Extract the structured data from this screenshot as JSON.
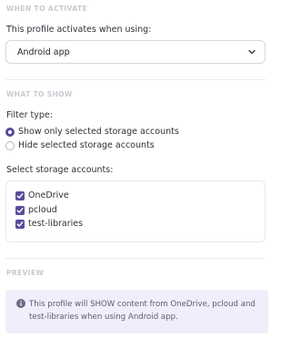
{
  "activate": {
    "section_title": "WHEN TO ACTIVATE",
    "prompt": "This profile activates when using:",
    "selected": "Android app"
  },
  "show": {
    "section_title": "WHAT TO SHOW",
    "filter_label": "Filter type:",
    "options": [
      {
        "label": "Show only selected storage accounts",
        "selected": true
      },
      {
        "label": "Hide selected storage accounts",
        "selected": false
      }
    ],
    "accounts_label": "Select storage accounts:",
    "accounts": [
      {
        "label": "OneDrive",
        "checked": true
      },
      {
        "label": "pcloud",
        "checked": true
      },
      {
        "label": "test-libraries",
        "checked": true
      }
    ]
  },
  "preview": {
    "section_title": "PREVIEW",
    "text": "This profile will SHOW content from OneDrive, pcloud and test-libraries when using Android app."
  },
  "colors": {
    "accent": "#5a4a9c",
    "preview_bg": "#efeefa"
  }
}
